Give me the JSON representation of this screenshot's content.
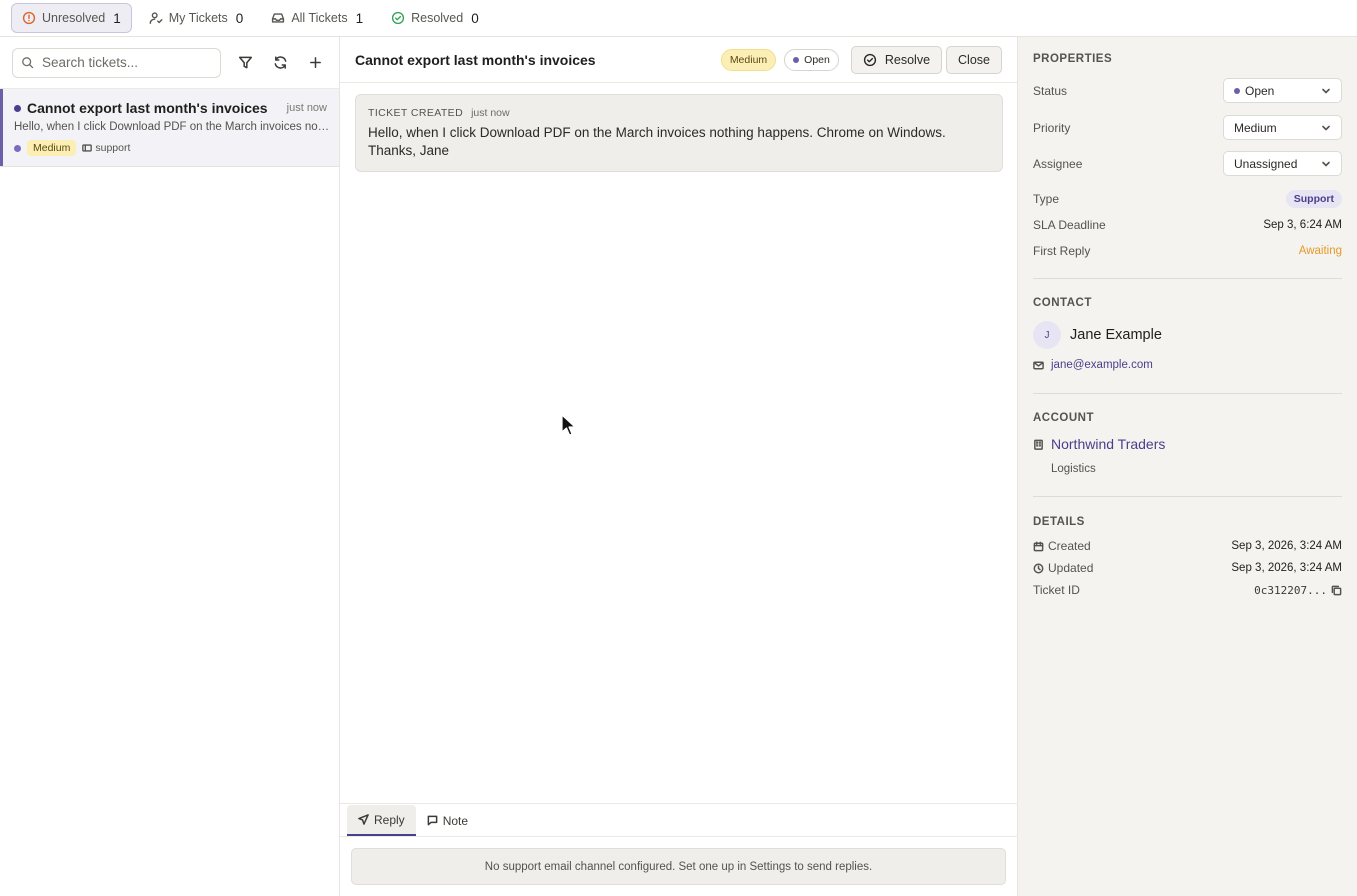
{
  "filter_tabs": [
    {
      "label": "Unresolved",
      "count": "1",
      "icon": "alert-circle-icon",
      "active": true
    },
    {
      "label": "My Tickets",
      "count": "0",
      "icon": "user-check-icon"
    },
    {
      "label": "All Tickets",
      "count": "1",
      "icon": "inbox-icon"
    },
    {
      "label": "Resolved",
      "count": "0",
      "icon": "check-circle-icon"
    }
  ],
  "list": {
    "search_placeholder": "Search tickets...",
    "tickets": [
      {
        "title": "Cannot export last month's invoices",
        "time": "just now",
        "preview": "Hello, when I click Download PDF on the March invoices nothing happens. Chrome on Windows. Thanks, Jane",
        "priority": "Medium",
        "tag": "support"
      }
    ]
  },
  "ticket": {
    "title": "Cannot export last month's invoices",
    "priority": "Medium",
    "status": "Open",
    "resolve_label": "Resolve",
    "close_label": "Close",
    "event": {
      "label": "TICKET CREATED",
      "time": "just now",
      "body": "Hello, when I click Download PDF on the March invoices nothing happens. Chrome on Windows. Thanks, Jane"
    },
    "reply_tabs": [
      "Reply",
      "Note"
    ],
    "notice": "No support email channel configured. Set one up in Settings to send replies."
  },
  "properties": {
    "title": "PROPERTIES",
    "status_label": "Status",
    "status_value": "Open",
    "priority_label": "Priority",
    "priority_value": "Medium",
    "assignee_label": "Assignee",
    "assignee_value": "Unassigned",
    "type_label": "Type",
    "type_value": "Support",
    "sla_label": "SLA Deadline",
    "sla_value": "Sep 3, 6:24 AM",
    "first_reply_label": "First Reply",
    "first_reply_value": "Awaiting"
  },
  "contact": {
    "title": "CONTACT",
    "initial": "J",
    "name": "Jane Example",
    "email": "jane@example.com"
  },
  "account": {
    "title": "ACCOUNT",
    "name": "Northwind Traders",
    "industry": "Logistics"
  },
  "details": {
    "title": "DETAILS",
    "created_label": "Created",
    "created_value": "Sep 3, 2026, 3:24 AM",
    "updated_label": "Updated",
    "updated_value": "Sep 3, 2026, 3:24 AM",
    "ticket_id_label": "Ticket ID",
    "ticket_id_value": "0c312207..."
  },
  "colors": {
    "accent": "#4a3f8a",
    "medium_badge": "#fcefb6",
    "awaiting": "#e59a2a"
  }
}
